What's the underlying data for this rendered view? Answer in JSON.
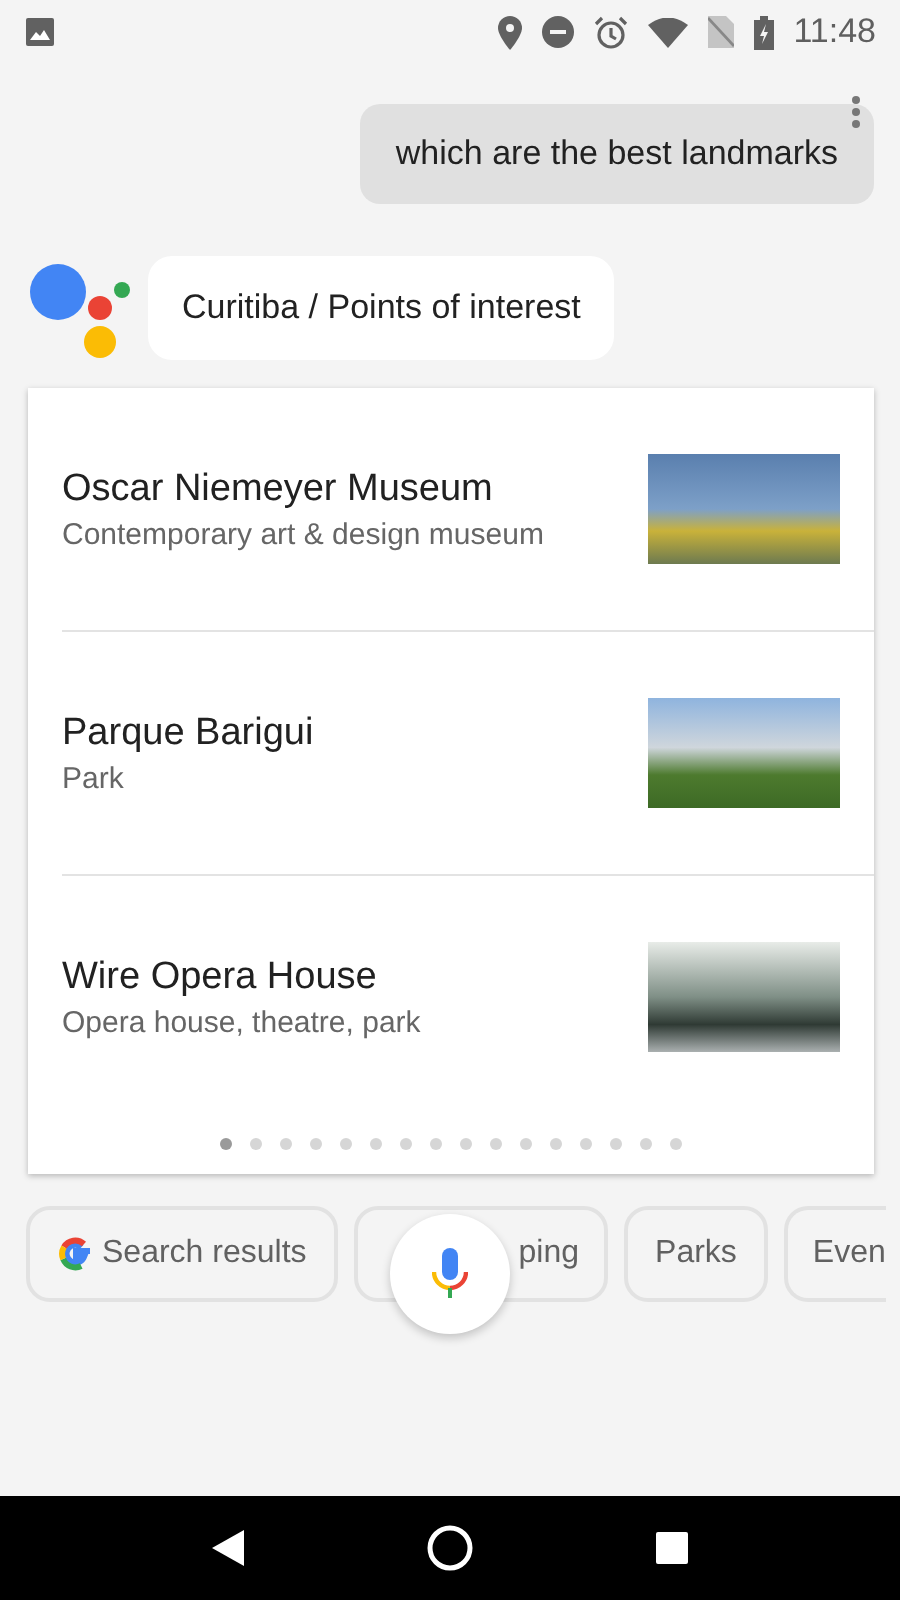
{
  "status_bar": {
    "time": "11:48"
  },
  "query": {
    "text": "which are the best landmarks"
  },
  "reply": {
    "text": "Curitiba / Points of interest"
  },
  "places": [
    {
      "name": "Oscar Niemeyer Museum",
      "description": "Contemporary art & design museum"
    },
    {
      "name": "Parque Barigui",
      "description": "Park"
    },
    {
      "name": "Wire Opera House",
      "description": "Opera house, theatre, park"
    }
  ],
  "pager": [
    {
      "selected": true
    },
    {
      "selected": false
    },
    {
      "selected": false
    },
    {
      "selected": false
    },
    {
      "selected": false
    },
    {
      "selected": false
    },
    {
      "selected": false
    },
    {
      "selected": false
    },
    {
      "selected": false
    },
    {
      "selected": false
    },
    {
      "selected": false
    },
    {
      "selected": false
    },
    {
      "selected": false
    },
    {
      "selected": false
    },
    {
      "selected": false
    },
    {
      "selected": false
    }
  ],
  "suggestions": [
    {
      "kind": "search",
      "label": "Search results",
      "cut_off": false
    },
    {
      "kind": "plain",
      "label": "ping",
      "cut_off": false
    },
    {
      "kind": "plain",
      "label": "Parks",
      "cut_off": false
    },
    {
      "kind": "plain",
      "label": "Even",
      "cut_off": true
    }
  ]
}
